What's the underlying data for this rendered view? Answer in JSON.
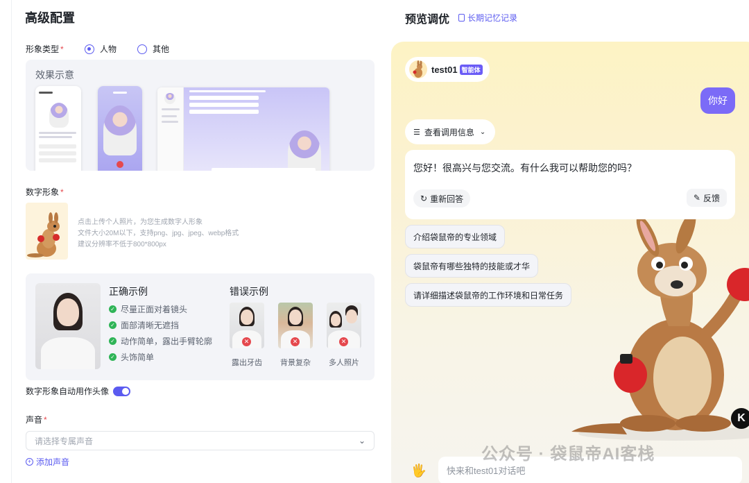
{
  "config": {
    "title": "高级配置",
    "type_label": "形象类型",
    "type_options": [
      "人物",
      "其他"
    ],
    "type_selected": "人物",
    "demo_title": "效果示意",
    "avatar_label": "数字形象",
    "avatar_hints": [
      "点击上传个人照片，为您生成数字人形象",
      "文件大小20M以下，支持png、jpg、jpeg、webp格式",
      "建议分辨率不低于800*800px"
    ],
    "correct_title": "正确示例",
    "correct_items": [
      "尽量正面对着镜头",
      "面部清晰无遮挡",
      "动作简单，露出手臂轮廓",
      "头饰简单"
    ],
    "wrong_title": "错误示例",
    "wrong_items": [
      "露出牙齿",
      "背景复杂",
      "多人照片"
    ],
    "auto_avatar_label": "数字形象自动用作头像",
    "auto_avatar_on": true,
    "voice_label": "声音",
    "voice_placeholder": "请选择专属声音",
    "add_voice": "添加声音"
  },
  "preview": {
    "title": "预览调优",
    "memory_link": "长期记忆记录",
    "agent_name": "test01",
    "agent_tag": "智能体",
    "user_message": "你好",
    "info_toggle": "查看调用信息",
    "reply": "您好！很高兴与您交流。有什么我可以帮助您的吗？",
    "regenerate": "重新回答",
    "feedback": "反馈",
    "suggestions": [
      "介绍袋鼠帝的专业领域",
      "袋鼠帝有哪些独特的技能或才华",
      "请详细描述袋鼠帝的工作环境和日常任务"
    ],
    "input_placeholder": "快来和test01对话吧"
  },
  "watermark": "公众号 · 袋鼠帝AI客栈",
  "badge": "K",
  "colors": {
    "accent": "#5b5bf0",
    "error": "#e5484d",
    "success": "#2fb457",
    "bubble": "#7b6bf7"
  }
}
